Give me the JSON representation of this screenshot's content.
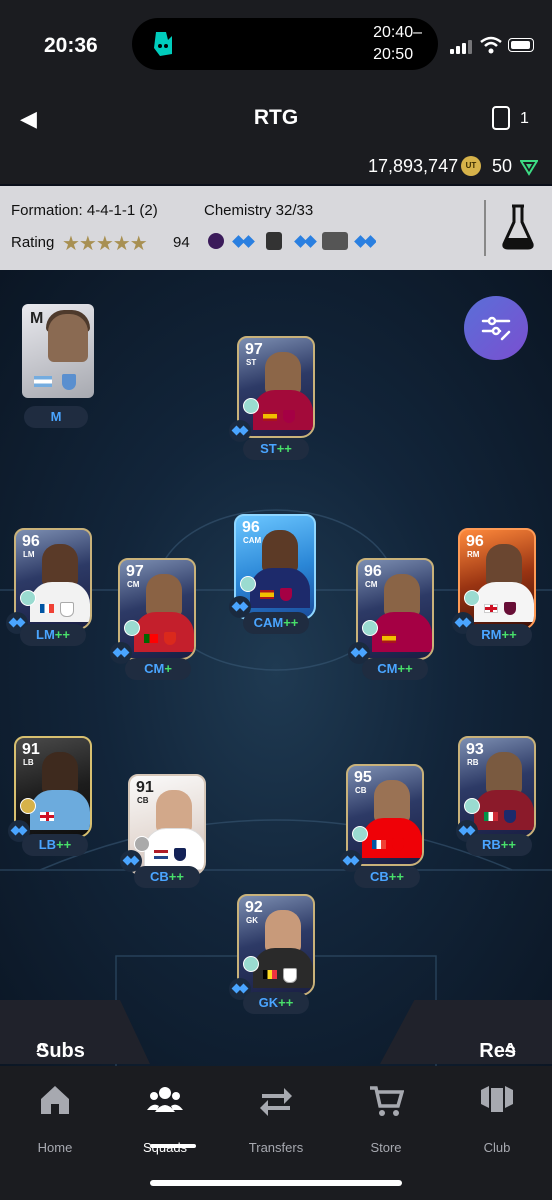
{
  "status_bar": {
    "time": "20:36",
    "app_logo": "deliveroo-kangaroo-icon",
    "live_range_top": "20:40–",
    "live_range_bottom": "20:50"
  },
  "header": {
    "back_icon": "back-arrow-icon",
    "title": "RTG",
    "card_count": "1",
    "coins": "17,893,747",
    "points": "50"
  },
  "info": {
    "formation": "Formation: 4-4-1-1 (2)",
    "chemistry": "Chemistry 32/33",
    "rating_label": "Rating",
    "stars": "★★★★★",
    "rating": "94"
  },
  "manager": {
    "tag": "M",
    "letter": "M"
  },
  "players": [
    {
      "rating": "97",
      "pos": "ST",
      "tag_pos": "ST",
      "tag_plus": "++"
    },
    {
      "rating": "96",
      "pos": "LM",
      "tag_pos": "LM",
      "tag_plus": "++"
    },
    {
      "rating": "97",
      "pos": "CM",
      "tag_pos": "CM",
      "tag_plus": "+"
    },
    {
      "rating": "96",
      "pos": "CAM",
      "tag_pos": "CAM",
      "tag_plus": "++"
    },
    {
      "rating": "96",
      "pos": "CM",
      "tag_pos": "CM",
      "tag_plus": "++"
    },
    {
      "rating": "96",
      "pos": "RM",
      "tag_pos": "RM",
      "tag_plus": "++"
    },
    {
      "rating": "91",
      "pos": "LB",
      "tag_pos": "LB",
      "tag_plus": "++"
    },
    {
      "rating": "91",
      "pos": "CB",
      "tag_pos": "CB",
      "tag_plus": "++"
    },
    {
      "rating": "95",
      "pos": "CB",
      "tag_pos": "CB",
      "tag_plus": "++"
    },
    {
      "rating": "93",
      "pos": "RB",
      "tag_pos": "RB",
      "tag_plus": "++"
    },
    {
      "rating": "92",
      "pos": "GK",
      "tag_pos": "GK",
      "tag_plus": "++"
    }
  ],
  "subs": {
    "label": "Subs"
  },
  "res": {
    "label": "Res"
  },
  "nav": {
    "home": "Home",
    "squads": "Squads",
    "transfers": "Transfers",
    "store": "Store",
    "club": "Club",
    "active": "Squads"
  }
}
